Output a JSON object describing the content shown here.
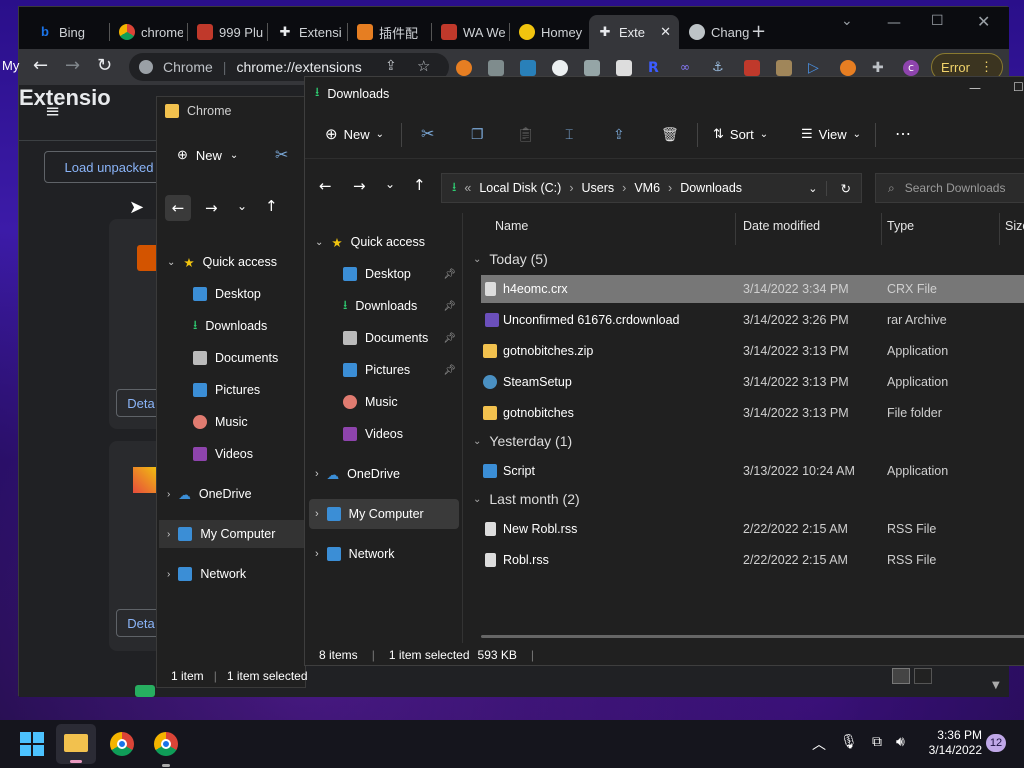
{
  "browser": {
    "tabs": [
      {
        "label": "Bing",
        "color": "#1a73e8"
      },
      {
        "label": "chrome",
        "color": "#e8eaed"
      },
      {
        "label": "999 Plu",
        "color": "#c0392b"
      },
      {
        "label": "Extensi",
        "color": "#e8eaed"
      },
      {
        "label": "插件配",
        "color": "#e67e22"
      },
      {
        "label": "WA We",
        "color": "#c0392b"
      },
      {
        "label": "Homey",
        "color": "#f1c40f"
      },
      {
        "label": "Exte",
        "color": "#e8eaed",
        "active": true
      },
      {
        "label": "Chang",
        "color": "#bdc3c7"
      }
    ],
    "address_scheme": "Chrome",
    "address_url": "chrome://extensions",
    "error_label": "Error",
    "side_label": "My"
  },
  "extensions_page": {
    "title": "Extensio",
    "load_unpacked": "Load unpacked",
    "details_label": "Deta"
  },
  "explorer_back": {
    "title": "Chrome",
    "new_label": "New",
    "nav": [
      {
        "label": "Quick access",
        "icon": "star-icon"
      },
      {
        "label": "Desktop",
        "icon": "desktop-icon"
      },
      {
        "label": "Downloads",
        "icon": "download-icon"
      },
      {
        "label": "Documents",
        "icon": "document-icon"
      },
      {
        "label": "Pictures",
        "icon": "pictures-icon"
      },
      {
        "label": "Music",
        "icon": "music-icon"
      },
      {
        "label": "Videos",
        "icon": "videos-icon"
      },
      {
        "label": "OneDrive",
        "icon": "cloud-icon"
      },
      {
        "label": "My Computer",
        "icon": "computer-icon"
      },
      {
        "label": "Network",
        "icon": "network-icon"
      }
    ],
    "status_items": "1 item",
    "status_selected": "1 item selected"
  },
  "explorer_front": {
    "title": "Downloads",
    "new_label": "New",
    "sort_label": "Sort",
    "view_label": "View",
    "breadcrumb": {
      "root": "Local Disk (C:)",
      "users": "Users",
      "user": "VM6",
      "folder": "Downloads"
    },
    "search_placeholder": "Search Downloads",
    "nav": [
      {
        "label": "Quick access"
      },
      {
        "label": "Desktop"
      },
      {
        "label": "Downloads"
      },
      {
        "label": "Documents"
      },
      {
        "label": "Pictures"
      },
      {
        "label": "Music"
      },
      {
        "label": "Videos"
      },
      {
        "label": "OneDrive"
      },
      {
        "label": "My Computer"
      },
      {
        "label": "Network"
      }
    ],
    "columns": {
      "name": "Name",
      "date": "Date modified",
      "type": "Type",
      "size": "Size"
    },
    "groups": [
      {
        "label": "Today (5)",
        "files": [
          {
            "name": "h4eomc.crx",
            "date": "3/14/2022 3:34 PM",
            "type": "CRX File"
          },
          {
            "name": "Unconfirmed 61676.crdownload",
            "date": "3/14/2022 3:26 PM",
            "type": "rar Archive"
          },
          {
            "name": "gotnobitches.zip",
            "date": "3/14/2022 3:13 PM",
            "type": "Application"
          },
          {
            "name": "SteamSetup",
            "date": "3/14/2022 3:13 PM",
            "type": "Application"
          },
          {
            "name": "gotnobitches",
            "date": "3/14/2022 3:13 PM",
            "type": "File folder"
          }
        ]
      },
      {
        "label": "Yesterday (1)",
        "files": [
          {
            "name": "Script",
            "date": "3/13/2022 10:24 AM",
            "type": "Application"
          }
        ]
      },
      {
        "label": "Last month (2)",
        "files": [
          {
            "name": "New Robl.rss",
            "date": "2/22/2022 2:15 AM",
            "type": "RSS File"
          },
          {
            "name": "Robl.rss",
            "date": "2/22/2022 2:15 AM",
            "type": "RSS File"
          }
        ]
      }
    ],
    "status": {
      "count": "8 items",
      "selected": "1 item selected",
      "size": "593 KB"
    }
  },
  "taskbar": {
    "time": "3:36 PM",
    "date": "3/14/2022",
    "badge": "12"
  }
}
